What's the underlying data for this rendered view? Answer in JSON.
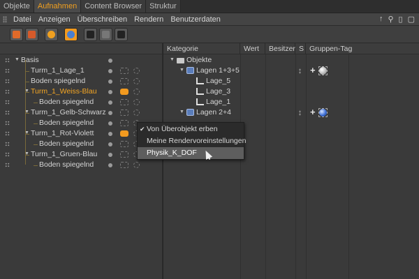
{
  "tabs": [
    {
      "label": "Objekte",
      "active": false
    },
    {
      "label": "Aufnahmen",
      "active": true
    },
    {
      "label": "Content Browser",
      "active": false
    },
    {
      "label": "Struktur",
      "active": false
    }
  ],
  "menu": [
    "Datei",
    "Anzeigen",
    "Überschreiben",
    "Rendern",
    "Benutzerdaten"
  ],
  "menu_right_icons": [
    "arrow-up-icon",
    "search-icon",
    "panel-icon",
    "window-icon"
  ],
  "toolbar_icons": [
    "new-take-icon",
    "new-take-from-selection-icon",
    "auto-take-icon",
    "override-group-icon",
    "render-all-takes-icon",
    "render-marked-takes-icon",
    "clapper-icon"
  ],
  "left_tree": [
    {
      "label": "Basis",
      "indent": 0,
      "orange": false,
      "expander": true,
      "activeIcon": false
    },
    {
      "label": "Turm_1_Lage_1",
      "indent": 1,
      "orange": false,
      "expander": false,
      "activeIcon": false
    },
    {
      "label": "Boden spiegelnd",
      "indent": 1,
      "orange": false,
      "expander": false,
      "activeIcon": false
    },
    {
      "label": "Turm_1_Weiss-Blau",
      "indent": 1,
      "orange": true,
      "expander": true,
      "activeIcon": true
    },
    {
      "label": "Boden spiegelnd",
      "indent": 2,
      "orange": false,
      "expander": false,
      "activeIcon": false
    },
    {
      "label": "Turm_1_Gelb-Schwarz",
      "indent": 1,
      "orange": false,
      "expander": true,
      "activeIcon": false
    },
    {
      "label": "Boden spiegelnd",
      "indent": 2,
      "orange": false,
      "expander": false,
      "activeIcon": false
    },
    {
      "label": "Turm_1_Rot-Violett",
      "indent": 1,
      "orange": false,
      "expander": true,
      "activeIcon": true
    },
    {
      "label": "Boden spiegelnd",
      "indent": 2,
      "orange": false,
      "expander": false,
      "activeIcon": false
    },
    {
      "label": "Turm_1_Gruen-Blau",
      "indent": 1,
      "orange": false,
      "expander": true,
      "activeIcon": false
    },
    {
      "label": "Boden spiegelnd",
      "indent": 2,
      "orange": false,
      "expander": false,
      "activeIcon": false
    }
  ],
  "columns": [
    "Kategorie",
    "Wert",
    "Besitzer",
    "S",
    "Gruppen-Tag"
  ],
  "right_tree": [
    {
      "label": "Objekte",
      "type": "folder",
      "indent": 0
    },
    {
      "label": "Lagen 1+3+5",
      "type": "layer",
      "indent": 1,
      "sdots": true,
      "sphere": "white"
    },
    {
      "label": "Lage_5",
      "type": "l",
      "indent": 2
    },
    {
      "label": "Lage_3",
      "type": "l",
      "indent": 2
    },
    {
      "label": "Lage_1",
      "type": "l",
      "indent": 2
    },
    {
      "label": "Lagen 2+4",
      "type": "layer",
      "indent": 1,
      "sdots": true,
      "sphere": "blue"
    }
  ],
  "context_menu": {
    "items": [
      {
        "label": "Von Überobjekt erben",
        "checked": true,
        "highlight": false
      },
      {
        "label": "Meine Rendervoreinstellungen",
        "checked": false,
        "highlight": false
      },
      {
        "label": "Physik_K_DOF",
        "checked": false,
        "highlight": true
      }
    ],
    "check_glyph": "✔"
  },
  "colors": {
    "accent": "#f29a1f",
    "active_text": "#f5a623",
    "panel_bg": "#3a3a3a"
  }
}
